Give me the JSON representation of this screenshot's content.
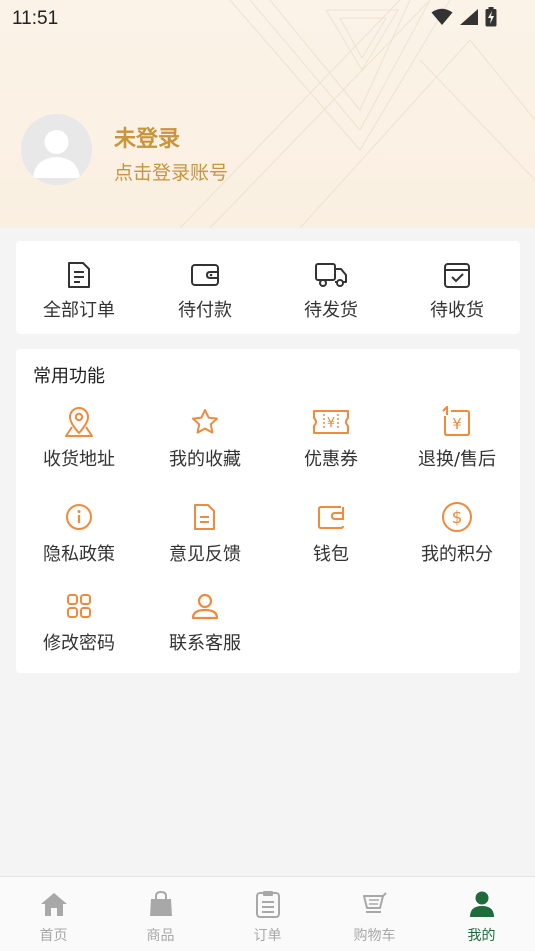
{
  "status_bar": {
    "time": "11:51"
  },
  "user": {
    "name": "未登录",
    "subtitle": "点击登录账号"
  },
  "orders": [
    {
      "label": "全部订单",
      "icon": "document-icon"
    },
    {
      "label": "待付款",
      "icon": "wallet-icon"
    },
    {
      "label": "待发货",
      "icon": "truck-icon"
    },
    {
      "label": "待收货",
      "icon": "box-check-icon"
    }
  ],
  "functions": {
    "title": "常用功能",
    "items": [
      {
        "label": "收货地址",
        "icon": "map-pin-icon"
      },
      {
        "label": "我的收藏",
        "icon": "star-icon"
      },
      {
        "label": "优惠券",
        "icon": "coupon-icon"
      },
      {
        "label": "退换/售后",
        "icon": "refund-icon"
      },
      {
        "label": "隐私政策",
        "icon": "info-icon"
      },
      {
        "label": "意见反馈",
        "icon": "feedback-icon"
      },
      {
        "label": "钱包",
        "icon": "wallet-icon"
      },
      {
        "label": "我的积分",
        "icon": "dollar-icon"
      },
      {
        "label": "修改密码",
        "icon": "grid-icon"
      },
      {
        "label": "联系客服",
        "icon": "person-icon"
      }
    ]
  },
  "bottom_nav": [
    {
      "label": "首页",
      "icon": "home-icon"
    },
    {
      "label": "商品",
      "icon": "bag-icon"
    },
    {
      "label": "订单",
      "icon": "clipboard-icon"
    },
    {
      "label": "购物车",
      "icon": "cart-icon"
    },
    {
      "label": "我的",
      "icon": "profile-icon",
      "active": true
    }
  ],
  "colors": {
    "accent": "#f08a3c",
    "gold": "#c8943c",
    "nav_active": "#1f6b3b",
    "nav_inactive": "#a8a8a8"
  }
}
